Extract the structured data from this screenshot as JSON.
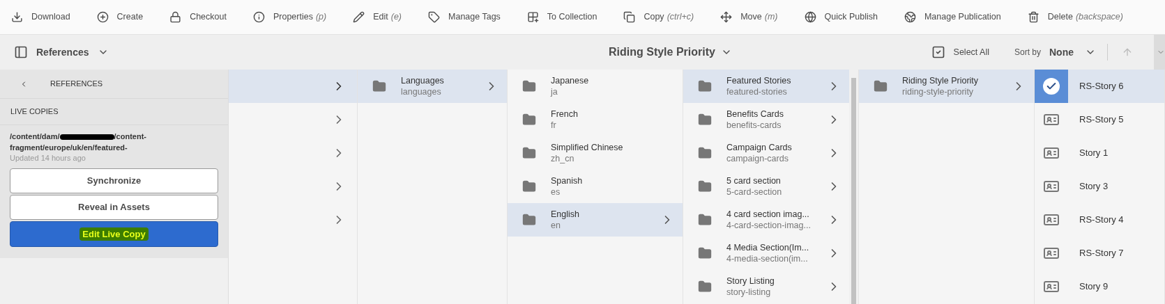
{
  "toolbar": [
    {
      "label": "Download"
    },
    {
      "label": "Create"
    },
    {
      "label": "Checkout"
    },
    {
      "label": "Properties",
      "shortcut": "(p)"
    },
    {
      "label": "Edit",
      "shortcut": "(e)"
    },
    {
      "label": "Manage Tags"
    },
    {
      "label": "To Collection"
    },
    {
      "label": "Copy",
      "shortcut": "(ctrl+c)"
    },
    {
      "label": "Move",
      "shortcut": "(m)"
    },
    {
      "label": "Quick Publish"
    },
    {
      "label": "Manage Publication"
    },
    {
      "label": "Delete",
      "shortcut": "(backspace)"
    }
  ],
  "header": {
    "rail_label": "References",
    "title": "Riding Style Priority",
    "select_all": "Select All",
    "sort_label": "Sort by",
    "sort_value": "None"
  },
  "references_panel": {
    "back_label": "REFERENCES",
    "section": "LIVE COPIES",
    "path_start": "/content/dam/",
    "path_end": "/content-fragment/europe/uk/en/featured-",
    "updated": "Updated 14 hours ago",
    "buttons": [
      {
        "label": "Synchronize",
        "kind": "secondary"
      },
      {
        "label": "Reveal in Assets",
        "kind": "secondary"
      },
      {
        "label": "Edit Live Copy",
        "kind": "primary"
      }
    ]
  },
  "columns": [
    {
      "kind": "arrows",
      "items": [
        {
          "selected": true
        },
        {
          "selected": false
        },
        {
          "selected": false
        },
        {
          "selected": false
        },
        {
          "selected": false
        }
      ]
    },
    {
      "kind": "folders",
      "items": [
        {
          "title": "Languages",
          "subtitle": "languages",
          "selected": true
        }
      ]
    },
    {
      "kind": "folders",
      "items": [
        {
          "title": "Japanese",
          "subtitle": "ja",
          "selected": false
        },
        {
          "title": "French",
          "subtitle": "fr",
          "selected": false
        },
        {
          "title": "Simplified Chinese",
          "subtitle": "zh_cn",
          "selected": false
        },
        {
          "title": "Spanish",
          "subtitle": "es",
          "selected": false
        },
        {
          "title": "English",
          "subtitle": "en",
          "selected": true
        }
      ]
    },
    {
      "kind": "scroll_folders",
      "items": [
        {
          "title": "Featured Stories",
          "subtitle": "featured-stories",
          "selected": true
        },
        {
          "title": "Benefits Cards",
          "subtitle": "benefits-cards",
          "selected": false
        },
        {
          "title": "Campaign Cards",
          "subtitle": "campaign-cards",
          "selected": false
        },
        {
          "title": "5 card section",
          "subtitle": "5-card-section",
          "selected": false
        },
        {
          "title": "4 card section imag...",
          "subtitle": "4-card-section-imag...",
          "selected": false
        },
        {
          "title": "4 Media Section(Im...",
          "subtitle": "4-media-section(im...",
          "selected": false
        },
        {
          "title": "Story Listing",
          "subtitle": "story-listing",
          "selected": false
        }
      ]
    },
    {
      "kind": "folders",
      "items": [
        {
          "title": "Riding Style Priority",
          "subtitle": "riding-style-priority",
          "selected": true
        }
      ]
    },
    {
      "kind": "fragments",
      "items": [
        {
          "title": "RS-Story 6",
          "selected": true
        },
        {
          "title": "RS-Story 5",
          "selected": false
        },
        {
          "title": "Story 1",
          "selected": false
        },
        {
          "title": "Story 3",
          "selected": false
        },
        {
          "title": "RS-Story 4",
          "selected": false
        },
        {
          "title": "RS-Story 7",
          "selected": false
        },
        {
          "title": "Story 9",
          "selected": false
        }
      ]
    }
  ]
}
